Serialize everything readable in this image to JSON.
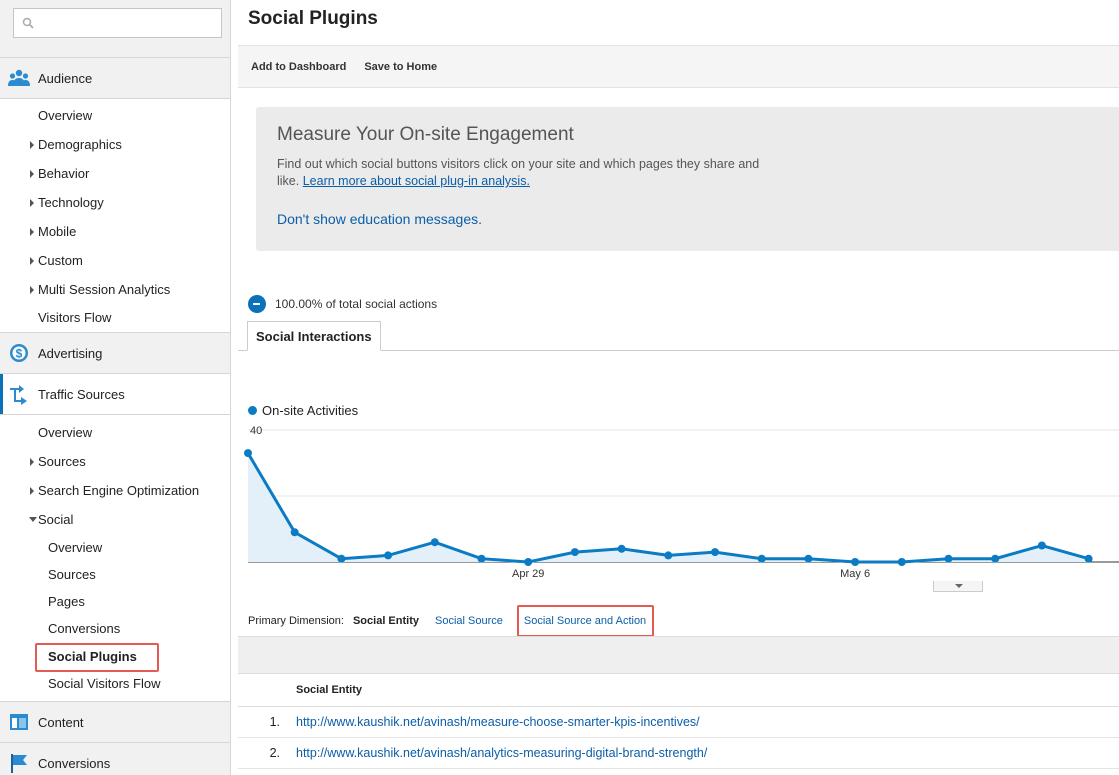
{
  "sidebar": {
    "search": {
      "placeholder": ""
    },
    "audience": {
      "label": "Audience",
      "items": [
        {
          "label": "Overview",
          "expandable": false
        },
        {
          "label": "Demographics",
          "expandable": true
        },
        {
          "label": "Behavior",
          "expandable": true
        },
        {
          "label": "Technology",
          "expandable": true
        },
        {
          "label": "Mobile",
          "expandable": true
        },
        {
          "label": "Custom",
          "expandable": true
        },
        {
          "label": "Multi Session Analytics",
          "expandable": true
        },
        {
          "label": "Visitors Flow",
          "expandable": false
        }
      ]
    },
    "advertising": {
      "label": "Advertising"
    },
    "traffic_sources": {
      "label": "Traffic Sources",
      "items": [
        {
          "label": "Overview"
        },
        {
          "label": "Sources"
        },
        {
          "label": "Search Engine Optimization"
        },
        {
          "label": "Social"
        }
      ],
      "social_items": [
        {
          "label": "Overview"
        },
        {
          "label": "Sources"
        },
        {
          "label": "Pages"
        },
        {
          "label": "Conversions"
        },
        {
          "label": "Social Plugins"
        },
        {
          "label": "Social Visitors Flow"
        }
      ]
    },
    "content": {
      "label": "Content"
    },
    "conversions": {
      "label": "Conversions"
    }
  },
  "main": {
    "title": "Social Plugins",
    "toolbar": {
      "add_dashboard": "Add to Dashboard",
      "save_home": "Save to Home"
    },
    "education": {
      "title": "Measure Your On-site Engagement",
      "text": "Find out which social buttons visitors click on your site and which pages they share and like.",
      "link": "Learn more about social plug-in analysis.",
      "dismiss": "Don't show education messages."
    },
    "percent_text": "100.00% of total social actions",
    "tab": "Social Interactions",
    "legend": "On-site Activities",
    "dimension": {
      "label": "Primary Dimension:",
      "active": "Social Entity",
      "options": [
        "Social Source",
        "Social Source and Action"
      ]
    },
    "table": {
      "column": "Social Entity",
      "rows": [
        {
          "num": "1.",
          "url": "http://www.kaushik.net/avinash/measure-choose-smarter-kpis-incentives/"
        },
        {
          "num": "2.",
          "url": "http://www.kaushik.net/avinash/analytics-measuring-digital-brand-strength/"
        }
      ]
    }
  },
  "colors": {
    "accent": "#0b7bc4",
    "highlight": "#e35b52",
    "link": "#0b5ea8"
  },
  "chart_data": {
    "type": "line",
    "series": [
      {
        "name": "On-site Activities",
        "values": [
          33,
          9,
          1,
          2,
          6,
          1,
          0,
          3,
          4,
          2,
          3,
          1,
          1,
          0,
          0,
          1,
          1,
          5,
          1
        ]
      }
    ],
    "ylim": [
      0,
      40
    ],
    "yticks": [
      20,
      40
    ],
    "xtick_labels": [
      {
        "index": 6,
        "label": "Apr 29"
      },
      {
        "index": 13,
        "label": "May 6"
      }
    ]
  }
}
